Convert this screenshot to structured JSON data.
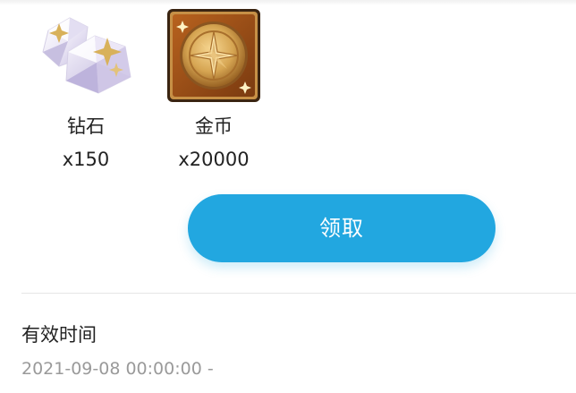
{
  "rewards": [
    {
      "icon": "diamond-icon",
      "name": "钻石",
      "quantity": "x150"
    },
    {
      "icon": "gold-coin-icon",
      "name": "金币",
      "quantity": "x20000"
    }
  ],
  "claim_button": {
    "label": "领取",
    "color": "#22a7e0"
  },
  "validity": {
    "label": "有效时间",
    "value": "2021-09-08 00:00:00 -"
  }
}
